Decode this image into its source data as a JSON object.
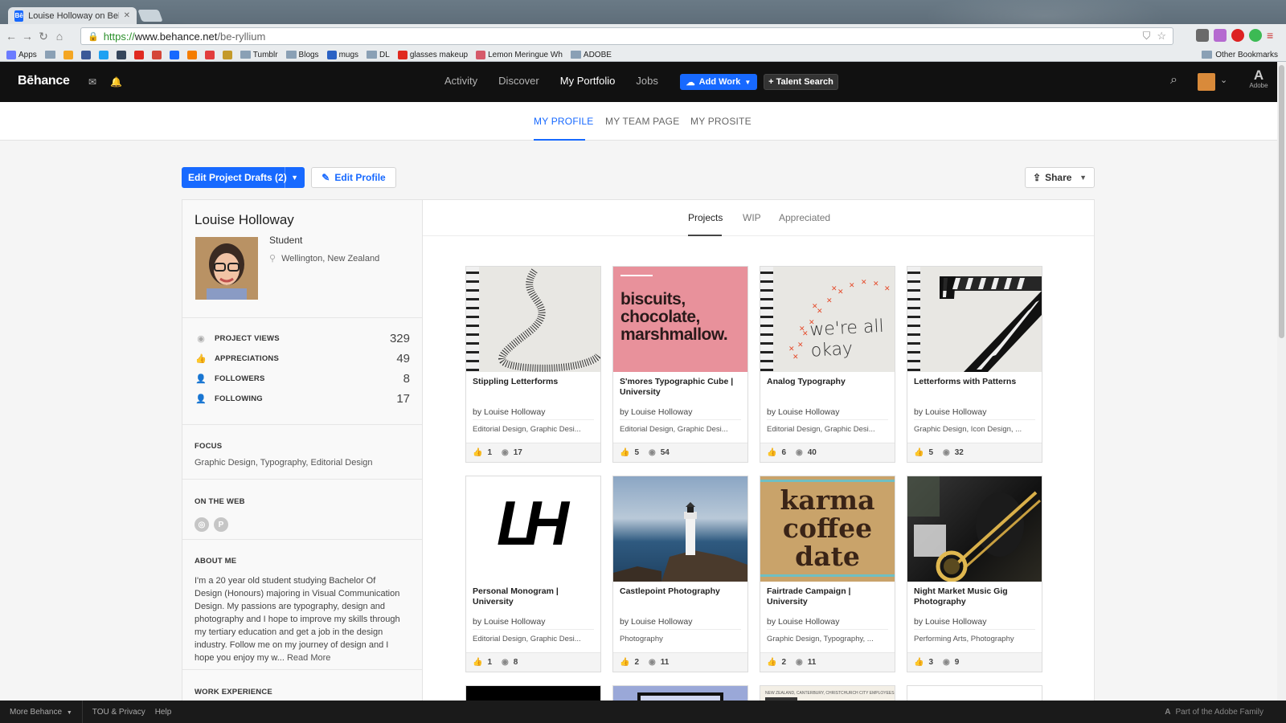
{
  "browser": {
    "tab_title": "Louise Holloway on Behance",
    "tab_favicon": "Bē",
    "url_https": "https://",
    "url_host": "www.behance.net",
    "url_path": "/be-ryllium",
    "bookmarks": [
      {
        "label": "Apps",
        "icon": "apps-icon",
        "color": "#6b7cff"
      },
      {
        "label": "",
        "icon": "folder-icon",
        "color": "#8aa0b5"
      },
      {
        "label": "",
        "icon": "bookmark-icon",
        "color": "#f4a623"
      },
      {
        "label": "",
        "icon": "facebook-icon",
        "color": "#3b5998"
      },
      {
        "label": "",
        "icon": "twitter-icon",
        "color": "#1da1f2"
      },
      {
        "label": "",
        "icon": "tumblr-icon",
        "color": "#35465c"
      },
      {
        "label": "",
        "icon": "youtube-icon",
        "color": "#e02a20"
      },
      {
        "label": "",
        "icon": "gmail-icon",
        "color": "#d44638"
      },
      {
        "label": "",
        "icon": "behance-icon",
        "color": "#1769ff"
      },
      {
        "label": "",
        "icon": "blogger-icon",
        "color": "#f57d00"
      },
      {
        "label": "",
        "icon": "alert-icon",
        "color": "#e23c3c"
      },
      {
        "label": "",
        "icon": "shield-icon",
        "color": "#c49a2a"
      },
      {
        "label": "Tumblr",
        "icon": "folder-icon",
        "color": "#8aa0b5"
      },
      {
        "label": "Blogs",
        "icon": "folder-icon",
        "color": "#8aa0b5"
      },
      {
        "label": "mugs",
        "icon": "vistaprint-icon",
        "color": "#2b62c4"
      },
      {
        "label": "DL",
        "icon": "folder-icon",
        "color": "#8aa0b5"
      },
      {
        "label": "glasses makeup",
        "icon": "youtube-icon",
        "color": "#e02a20"
      },
      {
        "label": "Lemon Meringue Wh",
        "icon": "page-icon",
        "color": "#d65a6a"
      },
      {
        "label": "ADOBE",
        "icon": "folder-icon",
        "color": "#8aa0b5"
      }
    ],
    "other_bookmarks": "Other Bookmarks"
  },
  "behance_nav": {
    "logo": "Bēhance",
    "links": [
      "Activity",
      "Discover",
      "My Portfolio",
      "Jobs"
    ],
    "active_link": "My Portfolio",
    "add_work": "Add Work",
    "talent_search": "+ Talent Search",
    "adobe_label": "Adobe"
  },
  "subnav": {
    "tabs": [
      "MY PROFILE",
      "MY TEAM PAGE",
      "MY PROSITE"
    ],
    "active": "MY PROFILE"
  },
  "actions": {
    "edit_drafts": "Edit Project Drafts (2)",
    "edit_profile": "Edit Profile",
    "share": "Share"
  },
  "profile": {
    "name": "Louise Holloway",
    "occupation": "Student",
    "location": "Wellington, New Zealand",
    "stats": [
      {
        "label": "PROJECT VIEWS",
        "value": "329",
        "icon": "eye-icon"
      },
      {
        "label": "APPRECIATIONS",
        "value": "49",
        "icon": "thumbs-up-icon"
      },
      {
        "label": "FOLLOWERS",
        "value": "8",
        "icon": "followers-icon"
      },
      {
        "label": "FOLLOWING",
        "value": "17",
        "icon": "following-icon"
      }
    ],
    "focus_heading": "FOCUS",
    "focus": "Graphic Design, Typography, Editorial Design",
    "web_heading": "ON THE WEB",
    "web_links": [
      "instagram-icon",
      "pinterest-icon"
    ],
    "about_heading": "ABOUT ME",
    "about": "I'm a 20 year old student studying Bachelor Of Design (Honours) majoring in Visual Communication Design. My passions are typography, design and photography and I hope to improve my skills through my tertiary education and get a job in the design industry. Follow me on my journey of design and I hope you enjoy my w...",
    "read_more": "Read More",
    "work_heading": "WORK EXPERIENCE"
  },
  "main_tabs": {
    "tabs": [
      "Projects",
      "WIP",
      "Appreciated"
    ],
    "active": "Projects"
  },
  "projects": [
    {
      "title": "Stippling Letterforms",
      "by": "by  Louise Holloway",
      "fields": "Editorial Design, Graphic Desi...",
      "appreciations": "1",
      "views": "17",
      "thumb": "stipple"
    },
    {
      "title": "S'mores Typographic Cube | University",
      "by": "by  Louise Holloway",
      "fields": "Editorial Design, Graphic Desi...",
      "appreciations": "5",
      "views": "54",
      "thumb": "pink",
      "thumb_text": "biscuits, chocolate, marshmallow."
    },
    {
      "title": "Analog Typography",
      "by": "by  Louise Holloway",
      "fields": "Editorial Design, Graphic Desi...",
      "appreciations": "6",
      "views": "40",
      "thumb": "analog",
      "thumb_text": "we're all okay"
    },
    {
      "title": "Letterforms with Patterns",
      "by": "by  Louise Holloway",
      "fields": "Graphic Design, Icon Design, ...",
      "appreciations": "5",
      "views": "32",
      "thumb": "zebra"
    },
    {
      "title": "Personal Monogram | University",
      "by": "by  Louise Holloway",
      "fields": "Editorial Design, Graphic Desi...",
      "appreciations": "1",
      "views": "8",
      "thumb": "mono",
      "thumb_text": "LH"
    },
    {
      "title": "Castlepoint Photography",
      "by": "by  Louise Holloway",
      "fields": "Photography",
      "appreciations": "2",
      "views": "11",
      "thumb": "sea"
    },
    {
      "title": "Fairtrade Campaign | University",
      "by": "by  Louise Holloway",
      "fields": "Graphic Design, Typography, ...",
      "appreciations": "2",
      "views": "11",
      "thumb": "karma",
      "thumb_text": "karma coffee date"
    },
    {
      "title": "Night Market Music Gig Photography",
      "by": "by  Louise Holloway",
      "fields": "Performing Arts, Photography",
      "appreciations": "3",
      "views": "9",
      "thumb": "music"
    }
  ],
  "partial_row": [
    "black",
    "monitor",
    "newsprint",
    "blank"
  ],
  "partial_text": "NEW ZEALAND, CANTERBURY, CHRISTCHURCH CITY EMPLOYEES",
  "footer": {
    "more": "More Behance",
    "tou": "TOU & Privacy",
    "help": "Help",
    "right": "Part of the Adobe Family"
  },
  "colors": {
    "accent": "#1769ff",
    "nav_bg": "#111111",
    "footer_bg": "#1a1a1a"
  }
}
